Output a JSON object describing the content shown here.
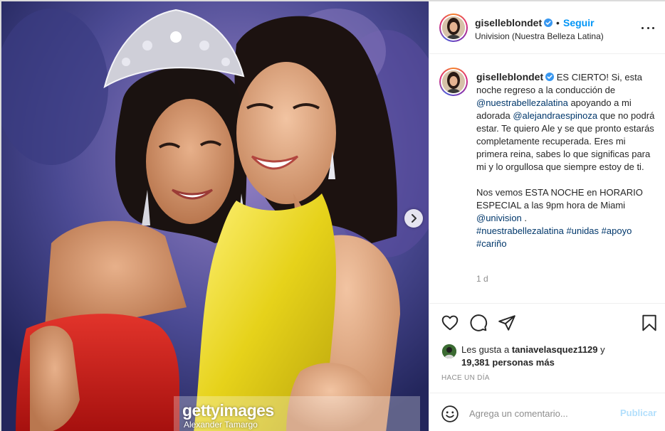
{
  "post": {
    "username": "giselleblondet",
    "follow_label": "Seguir",
    "separator": "•",
    "location": "Univision (Nuestra Belleza Latina)",
    "more_icon": "more-options-icon"
  },
  "photo": {
    "watermark_brand": "gettyimages",
    "watermark_credit": "Alexander Tamargo",
    "next_icon": "chevron-right-icon"
  },
  "caption": {
    "username": "giselleblondet",
    "t1": "ES CIERTO! Si, esta noche regreso a la conducción de ",
    "mention1": "@nuestrabellezalatina",
    "t2": " apoyando a mi adorada ",
    "mention2": "@alejandraespinoza",
    "t3": " que no podrá estar. Te quiero Ale y se que pronto estarás completamente recuperada. Eres mi primera reina, sabes lo que significas para mi y lo orgullosa que siempre estoy de ti.",
    "t4": "Nos vemos ESTA NOCHE en HORARIO ESPECIAL a las 9pm hora de Miami ",
    "mention3": "@univision",
    "t5": " .",
    "hashtags": [
      "#nuestrabellezalatina",
      "#unidas",
      "#apoyo",
      "#cariño"
    ],
    "time": "1 d"
  },
  "actions": {
    "like_icon": "heart-icon",
    "comment_icon": "comment-icon",
    "share_icon": "share-icon",
    "save_icon": "bookmark-icon"
  },
  "likes": {
    "prefix": "Les gusta a ",
    "user": "taniavelasquez1129",
    "mid": " y ",
    "count": "19,381 personas más"
  },
  "date_label": "HACE UN DÍA",
  "comment": {
    "placeholder": "Agrega un comentario...",
    "publish_label": "Publicar",
    "emoji_icon": "emoji-icon"
  },
  "colors": {
    "accent": "#0095f6",
    "link": "#00376b",
    "publish_disabled": "#b2dffc",
    "muted": "#8e8e8e"
  }
}
